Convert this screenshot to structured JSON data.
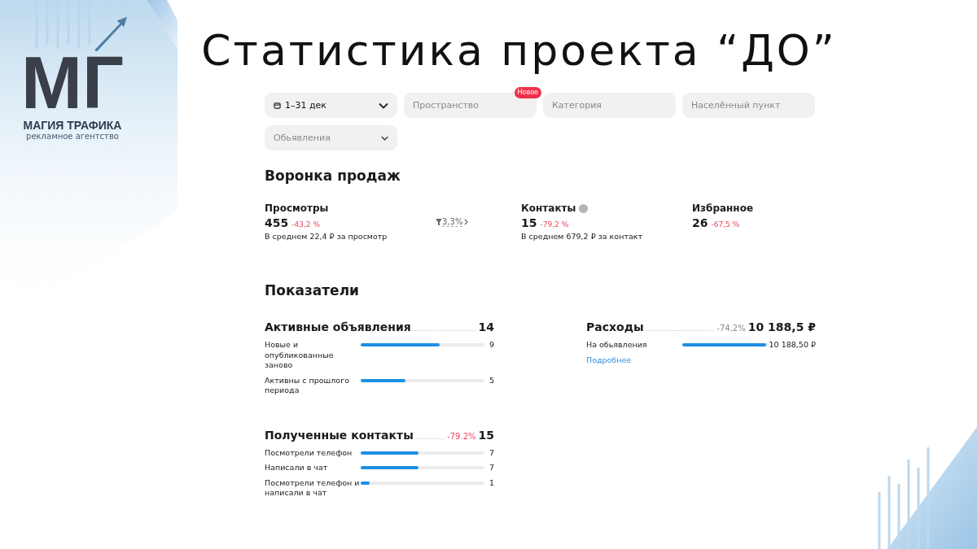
{
  "brand": {
    "mark": "МГ",
    "name": "МАГИЯ ТРАФИКА",
    "tagline": "рекламное агентство"
  },
  "title": "Статистика проекта “ДО”",
  "filters": [
    {
      "kind": "value",
      "text": "1–31 дек",
      "dropdown": true
    },
    {
      "kind": "placeholder",
      "text": "Пространство",
      "dropdown": false,
      "badge": "Новое"
    },
    {
      "kind": "placeholder",
      "text": "Категория",
      "dropdown": false
    },
    {
      "kind": "placeholder",
      "text": "Населённый пункт",
      "dropdown": false
    },
    {
      "kind": "placeholder",
      "text": "Обьявления",
      "dropdown": true
    }
  ],
  "funnel": {
    "title": "Воронка продаж",
    "items": [
      {
        "kind": "metric",
        "label": "Просмотры",
        "info": false,
        "value": "455",
        "change": "-43,2 %",
        "note": "В среднем 22,4 ₽ за просмотр"
      },
      {
        "kind": "conversion",
        "value": "3,3%"
      },
      {
        "kind": "metric",
        "label": "Контакты",
        "info": true,
        "value": "15",
        "change": "-79,2 %",
        "note": "В среднем 679,2 ₽ за контакт"
      },
      {
        "kind": "metric",
        "label": "Избранное",
        "info": false,
        "value": "26",
        "change": "-67,5 %"
      }
    ]
  },
  "indicators": {
    "title": "Показатели",
    "groups": [
      {
        "title": "Активные объявления",
        "total": "14",
        "rows": [
          {
            "label": "Новые и опубликованные заново",
            "level": 0.64,
            "value": "9"
          },
          {
            "label": "Активны с прошлого периода",
            "level": 0.36,
            "value": "5"
          }
        ]
      },
      {
        "title": "Расходы",
        "change": "-74,2%",
        "color": "#8a8a8a",
        "total": "10 188,5 ₽",
        "rows": [
          {
            "label": "На обьявления",
            "level": 0.97,
            "value": "10 188,50 ₽"
          }
        ],
        "link": "Подробнее"
      },
      {
        "title": "Полученные контакты",
        "change": "-79.2%",
        "color": "#f0455e",
        "total": "15",
        "rows": [
          {
            "label": "Посмотрели телефон",
            "level": 0.47,
            "value": "7"
          },
          {
            "label": "Написали в чат",
            "level": 0.47,
            "value": "7"
          },
          {
            "label": "Посмотрели телефон и написали в чат",
            "level": 0.07,
            "value": "1"
          }
        ]
      }
    ]
  }
}
